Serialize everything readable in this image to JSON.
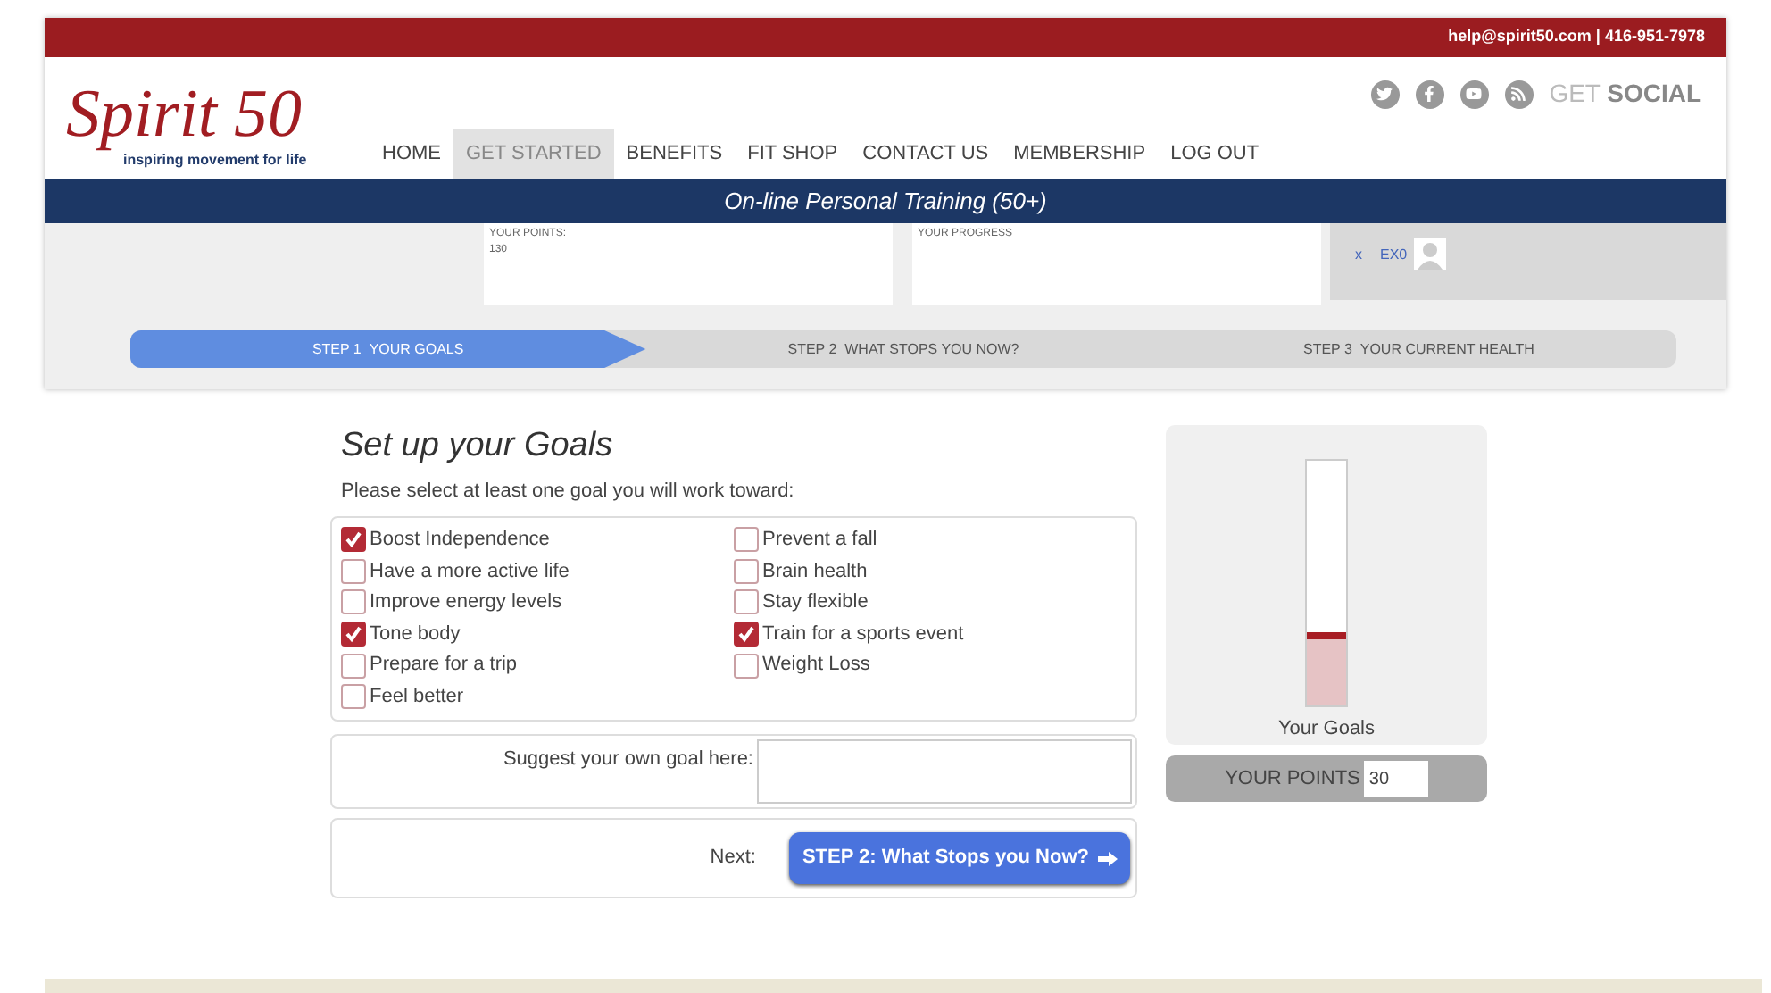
{
  "top_bar": {
    "contact": "help@spirit50.com | 416-951-7978"
  },
  "logo": {
    "name": "Spirit 50",
    "tagline": "inspiring movement for life"
  },
  "nav": [
    {
      "label": "HOME",
      "selected": false
    },
    {
      "label": "GET STARTED",
      "selected": true
    },
    {
      "label": "BENEFITS",
      "selected": false
    },
    {
      "label": "FIT SHOP",
      "selected": false
    },
    {
      "label": "CONTACT US",
      "selected": false
    },
    {
      "label": "MEMBERSHIP",
      "selected": false
    },
    {
      "label": "LOG OUT",
      "selected": false
    }
  ],
  "social": {
    "label_light": "GET",
    "label_bold": "SOCIAL"
  },
  "banner": "On-line Personal Training (50+)",
  "points_panel": {
    "points_label": "YOUR POINTS:",
    "points_value": "130",
    "progress_label": "YOUR PROGRESS",
    "close": "x",
    "user": "EX0"
  },
  "steps": [
    {
      "number": "STEP 1",
      "label": "YOUR GOALS",
      "selected": true
    },
    {
      "number": "STEP 2",
      "label": "WHAT STOPS YOU NOW?",
      "selected": false
    },
    {
      "number": "STEP 3",
      "label": "YOUR CURRENT HEALTH",
      "selected": false
    }
  ],
  "goals": {
    "title": "Set up your Goals",
    "instruction": "Please select at least one goal you will work toward:",
    "columns": [
      [
        {
          "label": "Boost Independence",
          "checked": true
        },
        {
          "label": "Have a more active life",
          "checked": false
        },
        {
          "label": "Improve energy levels",
          "checked": false
        },
        {
          "label": "Tone body",
          "checked": true
        },
        {
          "label": "Prepare for a trip",
          "checked": false
        },
        {
          "label": "Feel better",
          "checked": false
        }
      ],
      [
        {
          "label": "Prevent a fall",
          "checked": false
        },
        {
          "label": "Brain health",
          "checked": false
        },
        {
          "label": "Stay flexible",
          "checked": false
        },
        {
          "label": "Train for a sports event",
          "checked": true
        },
        {
          "label": "Weight Loss",
          "checked": false
        }
      ]
    ],
    "suggest_label": "Suggest your own goal here:",
    "next_label": "Next:",
    "next_button": "STEP 2: What Stops you Now?"
  },
  "gauge": {
    "label": "Your Goals",
    "level": 0.3,
    "points_label": "YOUR POINTS",
    "points_value": "30"
  }
}
